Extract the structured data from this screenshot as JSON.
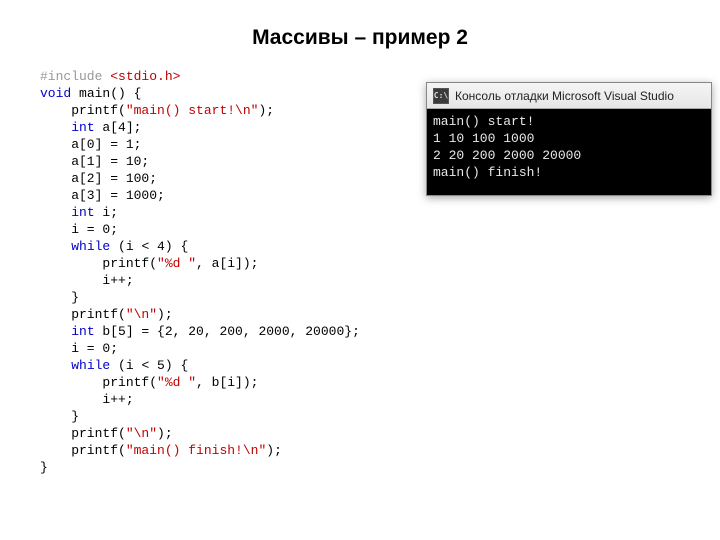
{
  "title": "Массивы – пример 2",
  "code": {
    "tokens": [
      {
        "c": "c-pre",
        "t": "#include "
      },
      {
        "c": "c-hdr",
        "t": "<stdio.h>"
      },
      {
        "t": "\n"
      },
      {
        "c": "c-kw",
        "t": "void"
      },
      {
        "t": " main() {\n"
      },
      {
        "t": "    printf("
      },
      {
        "c": "c-str",
        "t": "\"main() start!\\n\""
      },
      {
        "t": ");\n"
      },
      {
        "t": "    "
      },
      {
        "c": "c-kw",
        "t": "int"
      },
      {
        "t": " a[4];\n"
      },
      {
        "t": "    a[0] = 1;\n"
      },
      {
        "t": "    a[1] = 10;\n"
      },
      {
        "t": "    a[2] = 100;\n"
      },
      {
        "t": "    a[3] = 1000;\n"
      },
      {
        "t": "    "
      },
      {
        "c": "c-kw",
        "t": "int"
      },
      {
        "t": " i;\n"
      },
      {
        "t": "    i = 0;\n"
      },
      {
        "t": "    "
      },
      {
        "c": "c-kw",
        "t": "while"
      },
      {
        "t": " (i < 4) {\n"
      },
      {
        "t": "        printf("
      },
      {
        "c": "c-str",
        "t": "\"%d \""
      },
      {
        "t": ", a[i]);\n"
      },
      {
        "t": "        i++;\n"
      },
      {
        "t": "    }\n"
      },
      {
        "t": "    printf("
      },
      {
        "c": "c-str",
        "t": "\"\\n\""
      },
      {
        "t": ");\n"
      },
      {
        "t": "    "
      },
      {
        "c": "c-kw",
        "t": "int"
      },
      {
        "t": " b[5] = {2, 20, 200, 2000, 20000};\n"
      },
      {
        "t": "    i = 0;\n"
      },
      {
        "t": "    "
      },
      {
        "c": "c-kw",
        "t": "while"
      },
      {
        "t": " (i < 5) {\n"
      },
      {
        "t": "        printf("
      },
      {
        "c": "c-str",
        "t": "\"%d \""
      },
      {
        "t": ", b[i]);\n"
      },
      {
        "t": "        i++;\n"
      },
      {
        "t": "    }\n"
      },
      {
        "t": "    printf("
      },
      {
        "c": "c-str",
        "t": "\"\\n\""
      },
      {
        "t": ");\n"
      },
      {
        "t": "    printf("
      },
      {
        "c": "c-str",
        "t": "\"main() finish!\\n\""
      },
      {
        "t": ");\n"
      },
      {
        "t": "}\n"
      }
    ]
  },
  "console": {
    "icon_text": "C:\\",
    "title": "Консоль отладки Microsoft Visual Studio",
    "lines": [
      "main() start!",
      "1 10 100 1000",
      "2 20 200 2000 20000",
      "main() finish!"
    ]
  }
}
